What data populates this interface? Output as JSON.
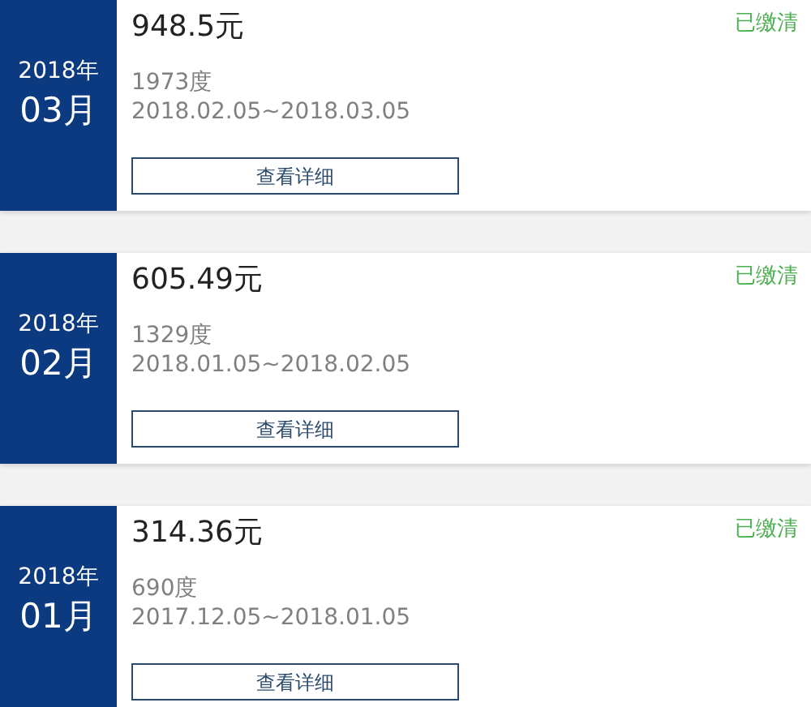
{
  "bills": [
    {
      "year": "2018年",
      "month": "03月",
      "amount": "948.5元",
      "status": "已缴清",
      "paid": true,
      "usage": "1973度",
      "period": "2018.02.05~2018.03.05",
      "button": "查看详细"
    },
    {
      "year": "2018年",
      "month": "02月",
      "amount": "605.49元",
      "status": "已缴清",
      "paid": true,
      "usage": "1329度",
      "period": "2018.01.05~2018.02.05",
      "button": "查看详细"
    },
    {
      "year": "2018年",
      "month": "01月",
      "amount": "314.36元",
      "status": "已缴清",
      "paid": true,
      "usage": "690度",
      "period": "2017.12.05~2018.01.05",
      "button": "查看详细"
    }
  ]
}
